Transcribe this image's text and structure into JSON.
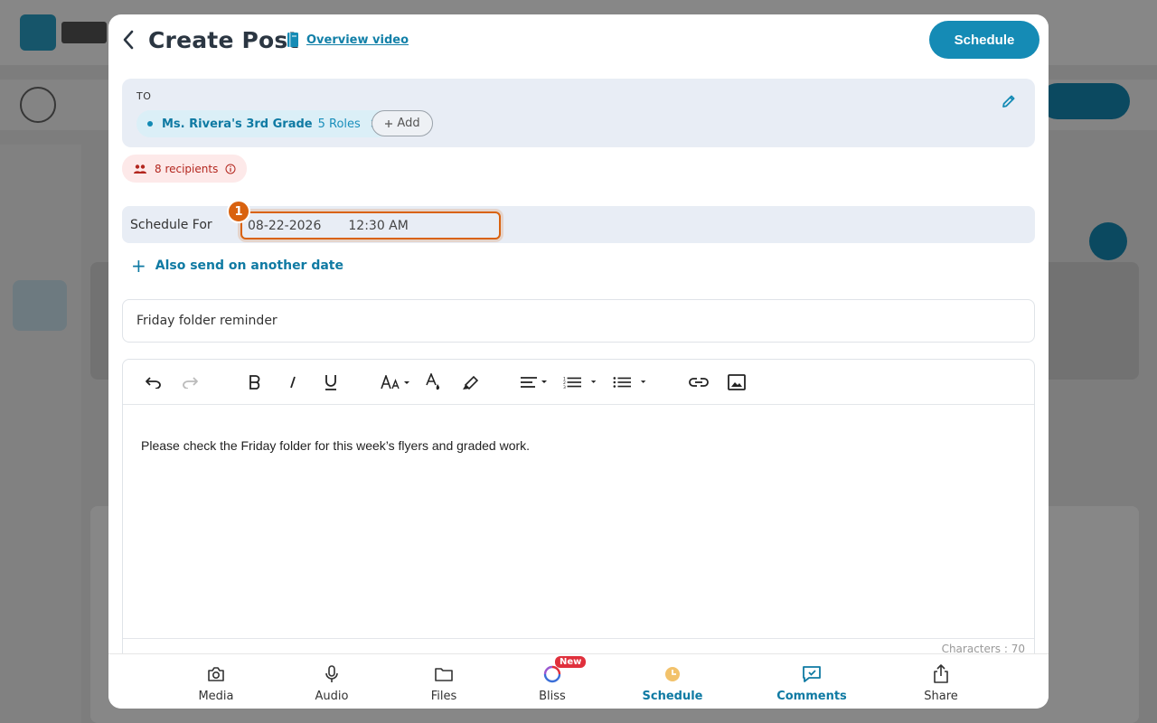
{
  "header": {
    "title": "Create Post",
    "overview_link": "Overview video",
    "schedule_button": "Schedule"
  },
  "recipients_box": {
    "to_label": "TO",
    "group_name": "Ms. Rivera's 3rd Grade",
    "roles": "5 Roles",
    "remove_symbol": "×",
    "add_label": "Add"
  },
  "recipients_badge": "8 recipients",
  "schedule": {
    "label": "Schedule For",
    "date": "08-22-2026",
    "time": "12:30 AM",
    "step_number": "1",
    "also_send": "Also send on another date"
  },
  "subject": "Friday folder reminder",
  "editor": {
    "body": "Please check the Friday folder for this week’s flyers and graded work.",
    "char_count": "Characters : 70",
    "toolbar": [
      "undo-icon",
      "redo-icon",
      "bold-icon",
      "italic-icon",
      "underline-icon",
      "font-size-icon",
      "font-color-icon",
      "highlight-icon",
      "align-icon",
      "numbered-list-icon",
      "bulleted-list-icon",
      "link-icon",
      "image-icon"
    ]
  },
  "bottom_bar": {
    "items": [
      {
        "label": "Media",
        "icon": "camera-icon"
      },
      {
        "label": "Audio",
        "icon": "microphone-icon"
      },
      {
        "label": "Files",
        "icon": "folder-icon"
      },
      {
        "label": "Bliss",
        "icon": "bliss-icon",
        "badge": "New"
      },
      {
        "label": "Schedule",
        "icon": "clock-icon",
        "active": true
      },
      {
        "label": "Comments",
        "icon": "comments-icon",
        "active": true
      },
      {
        "label": "Share",
        "icon": "share-icon"
      }
    ]
  },
  "colors": {
    "accent": "#158bb5",
    "highlight": "#d9620f",
    "danger": "#b3261e"
  }
}
